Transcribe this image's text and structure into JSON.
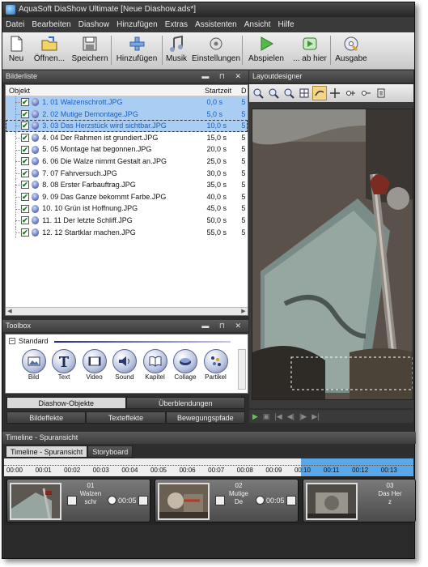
{
  "window": {
    "title": "AquaSoft DiaShow Ultimate [Neue Diashow.ads*]"
  },
  "menu": [
    "Datei",
    "Bearbeiten",
    "Diashow",
    "Hinzufügen",
    "Extras",
    "Assistenten",
    "Ansicht",
    "Hilfe"
  ],
  "toolbar": {
    "neu": "Neu",
    "oeffnen": "Öffnen...",
    "speichern": "Speichern",
    "hinzufuegen": "Hinzufügen",
    "musik": "Musik",
    "einstellungen": "Einstellungen",
    "abspielen": "Abspielen",
    "ab_hier": "... ab hier",
    "ausgabe": "Ausgabe"
  },
  "picture_list": {
    "panel_title": "Bilderliste",
    "col_object": "Objekt",
    "col_start": "Startzeit",
    "col_d": "D",
    "rows": [
      {
        "name": "1. 01 Walzenschrott.JPG",
        "start": "0,0 s",
        "d": "5"
      },
      {
        "name": "2. 02 Mutige Demontage.JPG",
        "start": "5,0 s",
        "d": "5"
      },
      {
        "name": "3. 03 Das Herzstück wird sichtbar.JPG",
        "start": "10,0 s",
        "d": "5"
      },
      {
        "name": "4. 04 Der Rahmen ist grundiert.JPG",
        "start": "15,0 s",
        "d": "5"
      },
      {
        "name": "5. 05 Montage hat begonnen.JPG",
        "start": "20,0 s",
        "d": "5"
      },
      {
        "name": "6. 06 Die Walze nimmt Gestalt an.JPG",
        "start": "25,0 s",
        "d": "5"
      },
      {
        "name": "7. 07 Fahrversuch.JPG",
        "start": "30,0 s",
        "d": "5"
      },
      {
        "name": "8. 08 Erster Farbauftrag.JPG",
        "start": "35,0 s",
        "d": "5"
      },
      {
        "name": "9. 09 Das Ganze bekommt Farbe.JPG",
        "start": "40,0 s",
        "d": "5"
      },
      {
        "name": "10. 10 Grün ist Hoffnung.JPG",
        "start": "45,0 s",
        "d": "5"
      },
      {
        "name": "11. 11 Der letzte Schliff.JPG",
        "start": "50,0 s",
        "d": "5"
      },
      {
        "name": "12. 12 Startklar machen.JPG",
        "start": "55,0 s",
        "d": "5"
      }
    ]
  },
  "toolbox": {
    "panel_title": "Toolbox",
    "section": "Standard",
    "items": [
      "Bild",
      "Text",
      "Video",
      "Sound",
      "Kapitel",
      "Collage",
      "Partikel"
    ],
    "tabs_row1": [
      "Diashow-Objekte",
      "Überblendungen"
    ],
    "tabs_row2": [
      "Bildeffekte",
      "Texteffekte",
      "Bewegungspfade"
    ]
  },
  "layout_designer": {
    "panel_title": "Layoutdesigner"
  },
  "timeline": {
    "panel_title": "Timeline - Spuransicht",
    "tabs": [
      "Timeline - Spuransicht",
      "Storyboard"
    ],
    "ticks": [
      "00:00",
      "00:01",
      "00:02",
      "00:03",
      "00:04",
      "00:05",
      "00:06",
      "00:07",
      "00:08",
      "00:09",
      "00:10",
      "00:11",
      "00:12",
      "00:13"
    ],
    "clips": [
      {
        "num": "01",
        "title": "Walzenschr",
        "duration": "00:05"
      },
      {
        "num": "02",
        "title": "Mutige De",
        "duration": "00:05"
      },
      {
        "num": "03",
        "title": "Das Herz",
        "duration": ""
      }
    ]
  },
  "colors": {
    "selection": "#a9cdf3",
    "timeline_highlight": "#5aa8ec",
    "dark_panel": "#2e2e2e"
  }
}
